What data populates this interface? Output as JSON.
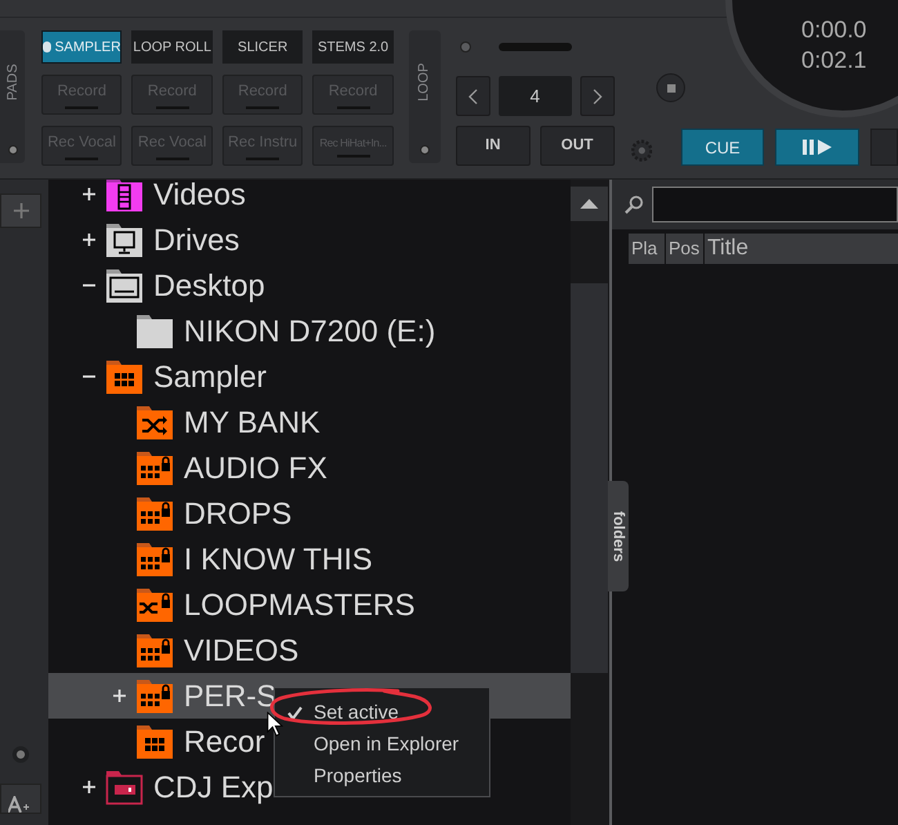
{
  "pad_modes": [
    {
      "label": "SAMPLER",
      "selected": true
    },
    {
      "label": "LOOP ROLL",
      "selected": false
    },
    {
      "label": "SLICER",
      "selected": false
    },
    {
      "label": "STEMS 2.0",
      "selected": false
    }
  ],
  "pads": [
    "Record",
    "Record",
    "Record",
    "Record",
    "Rec Vocal",
    "Rec Vocal",
    "Rec Instru",
    "Rec HiHat+In..."
  ],
  "pads_label": "PADS",
  "loop": {
    "label": "LOOP",
    "size": "4",
    "in": "IN",
    "out": "OUT"
  },
  "deck": {
    "elapsed": "0:00.0",
    "remaining": "0:02.1",
    "cue": "CUE"
  },
  "tree": [
    {
      "label": "Videos",
      "kind": "video",
      "expanded": false,
      "selected": false
    },
    {
      "label": "Drives",
      "kind": "computer",
      "expanded": false,
      "selected": false
    },
    {
      "label": "Desktop",
      "kind": "desktop",
      "expanded": true,
      "selected": false,
      "children": [
        {
          "label": "NIKON D7200 (E:)",
          "kind": "plain",
          "selected": false
        }
      ]
    },
    {
      "label": "Sampler",
      "kind": "grid",
      "expanded": true,
      "selected": false,
      "children": [
        {
          "label": "MY BANK",
          "kind": "shuffle",
          "selected": false
        },
        {
          "label": "AUDIO FX",
          "kind": "grid-lock",
          "selected": false
        },
        {
          "label": "DROPS",
          "kind": "grid-lock",
          "selected": false
        },
        {
          "label": "I KNOW THIS",
          "kind": "grid-lock",
          "selected": false
        },
        {
          "label": "LOOPMASTERS",
          "kind": "shuffle-lock",
          "selected": false
        },
        {
          "label": "VIDEOS",
          "kind": "grid-lock",
          "selected": false
        },
        {
          "label": "PER-S",
          "kind": "grid-lock",
          "expanded": false,
          "selected": true
        },
        {
          "label": "Recor",
          "kind": "grid",
          "selected": false
        }
      ]
    },
    {
      "label": "CDJ Exp",
      "kind": "usb",
      "expanded": false,
      "selected": false
    }
  ],
  "folders_tab": "folders",
  "columns": [
    "Pla",
    "Pos",
    "Title"
  ],
  "context_menu": [
    {
      "label": "Set active",
      "checked": true
    },
    {
      "label": "Open in Explorer",
      "checked": false
    },
    {
      "label": "Properties",
      "checked": false
    }
  ]
}
